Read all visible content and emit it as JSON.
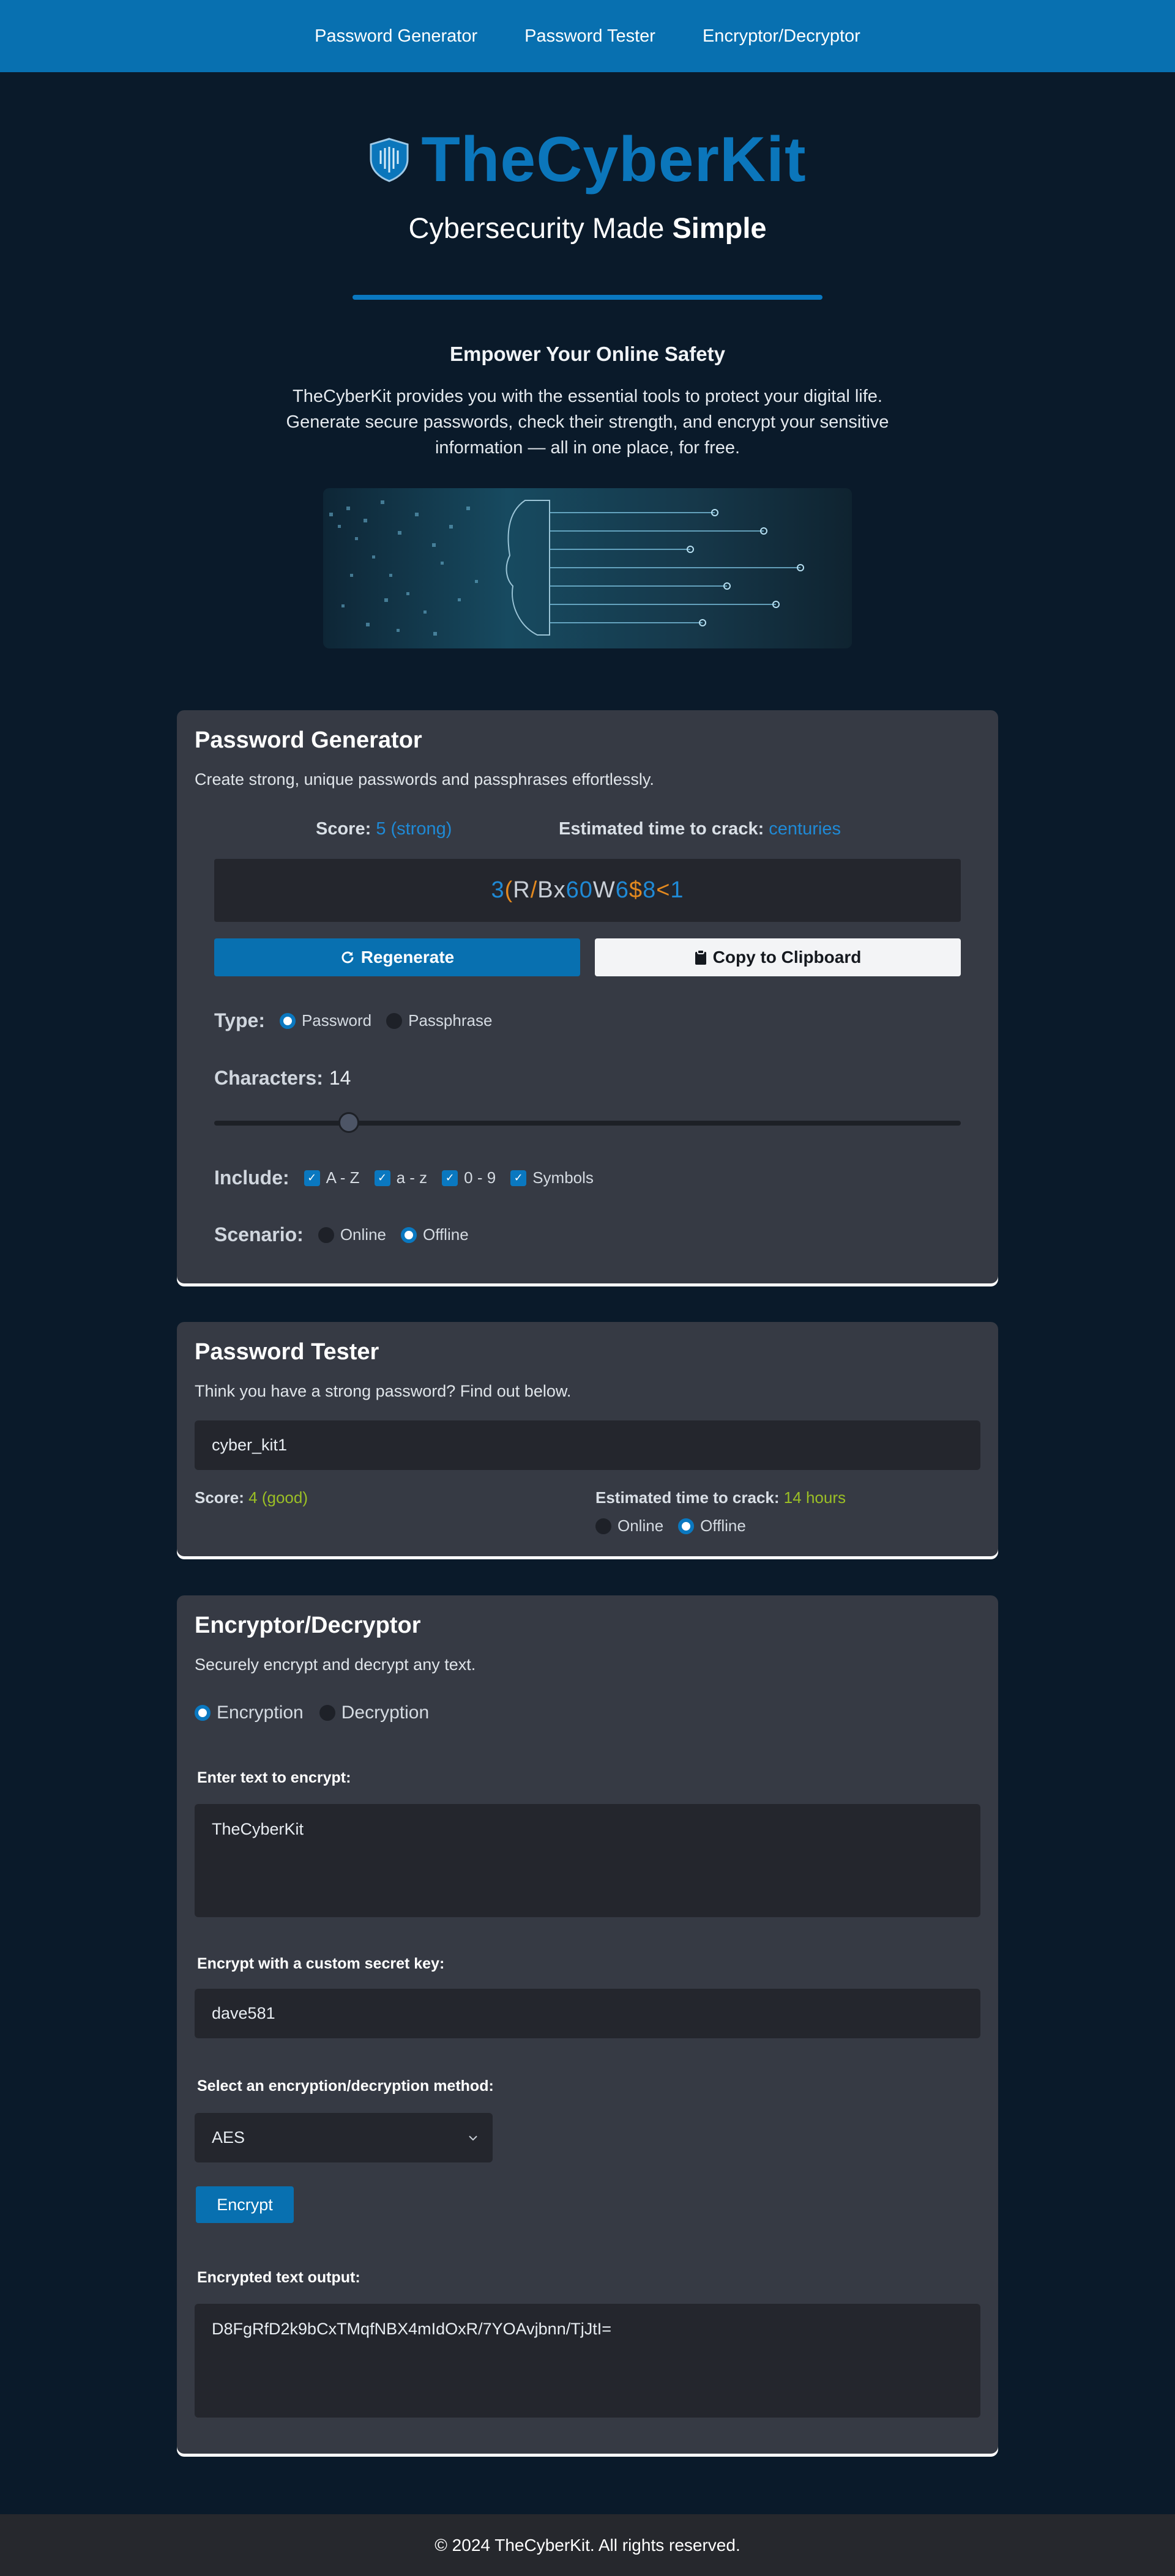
{
  "nav": {
    "items": [
      "Password Generator",
      "Password Tester",
      "Encryptor/Decryptor"
    ]
  },
  "hero": {
    "title": "TheCyberKit",
    "subtitle_prefix": "Cybersecurity Made ",
    "subtitle_bold": "Simple",
    "heading": "Empower Your Online Safety",
    "intro": "TheCyberKit provides you with the essential tools to protect your digital life. Generate secure passwords, check their strength, and encrypt your sensitive information — all in one place, for free.",
    "icon": "shield-icon"
  },
  "generator": {
    "title": "Password Generator",
    "description": "Create strong, unique passwords and passphrases effortlessly.",
    "score_label": "Score:",
    "score_value": "5 (strong)",
    "crack_label": "Estimated time to crack:",
    "crack_value": "centuries",
    "password_chars": [
      {
        "c": "3",
        "color": "#1f8ad6"
      },
      {
        "c": "(",
        "color": "#e3891f"
      },
      {
        "c": "R",
        "color": "#c8ced6"
      },
      {
        "c": "/",
        "color": "#e3891f"
      },
      {
        "c": "B",
        "color": "#c8ced6"
      },
      {
        "c": "x",
        "color": "#c8ced6"
      },
      {
        "c": "6",
        "color": "#1f8ad6"
      },
      {
        "c": "0",
        "color": "#1f8ad6"
      },
      {
        "c": "W",
        "color": "#c8ced6"
      },
      {
        "c": "6",
        "color": "#1f8ad6"
      },
      {
        "c": "$",
        "color": "#e3891f"
      },
      {
        "c": "8",
        "color": "#1f8ad6"
      },
      {
        "c": "<",
        "color": "#e3891f"
      },
      {
        "c": "1",
        "color": "#1f8ad6"
      }
    ],
    "regenerate_label": "Regenerate",
    "copy_label": "Copy to Clipboard",
    "type_label": "Type:",
    "type_options": [
      "Password",
      "Passphrase"
    ],
    "type_selected": "Password",
    "characters_label": "Characters:",
    "characters_value": "14",
    "characters_fraction": 0.18,
    "include_label": "Include:",
    "include_options": [
      "A - Z",
      "a - z",
      "0 - 9",
      "Symbols"
    ],
    "scenario_label": "Scenario:",
    "scenario_options": [
      "Online",
      "Offline"
    ],
    "scenario_selected": "Offline"
  },
  "tester": {
    "title": "Password Tester",
    "description": "Think you have a strong password? Find out below.",
    "input_value": "cyber_kit1",
    "score_label": "Score:",
    "score_value": "4 (good)",
    "crack_label": "Estimated time to crack:",
    "crack_value": "14 hours",
    "scenario_options": [
      "Online",
      "Offline"
    ],
    "scenario_selected": "Offline"
  },
  "crypto": {
    "title": "Encryptor/Decryptor",
    "description": "Securely encrypt and decrypt any text.",
    "mode_options": [
      "Encryption",
      "Decryption"
    ],
    "mode_selected": "Encryption",
    "text_label": "Enter text to encrypt:",
    "text_value": "TheCyberKit",
    "key_label": "Encrypt with a custom secret key:",
    "key_value": "dave581",
    "method_label": "Select an encryption/decryption method:",
    "method_value": "AES",
    "encrypt_button": "Encrypt",
    "output_label": "Encrypted text output:",
    "output_value": "D8FgRfD2k9bCxTMqfNBX4mIdOxR/7YOAvjbnn/TjJtI="
  },
  "footer": {
    "text": "© 2024 TheCyberKit. All rights reserved."
  },
  "colors": {
    "accent": "#0870b0",
    "strong": "#1f8ad6",
    "good": "#9bbf25",
    "background": "#0a1a2a",
    "card": "#363a44"
  }
}
